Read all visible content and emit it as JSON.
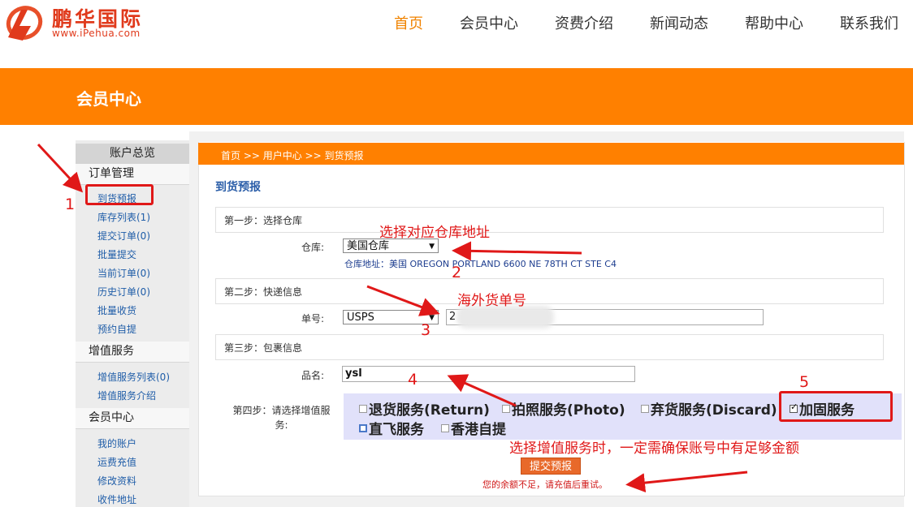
{
  "header": {
    "logo_text": "鹏华国际",
    "logo_url": "www.iPehua.com",
    "nav": [
      "首页",
      "会员中心",
      "资费介绍",
      "新闻动态",
      "帮助中心",
      "联系我们"
    ],
    "active_index": 0
  },
  "banner": {
    "title": "会员中心"
  },
  "sidebar": {
    "overview": "账户总览",
    "groups": [
      {
        "title": "订单管理",
        "items": [
          "到货预报",
          "库存列表(1)",
          "提交订单(0)",
          "批量提交",
          "当前订单(0)",
          "历史订单(0)",
          "批量收货",
          "预约自提"
        ]
      },
      {
        "title": "增值服务",
        "items": [
          "增值服务列表(0)",
          "增值服务介绍"
        ]
      },
      {
        "title": "会员中心",
        "items": [
          "我的账户",
          "运费充值",
          "修改资料",
          "收件地址"
        ]
      }
    ]
  },
  "breadcrumb": "首页 >> 用户中心 >> 到货预报",
  "form": {
    "title": "到货预报",
    "step1": "第一步：选择仓库",
    "warehouse_label": "仓库:",
    "warehouse_value": "美国仓库",
    "address": "仓库地址：美国 OREGON PORTLAND 6600 NE 78TH CT STE C4",
    "step2": "第二步：快递信息",
    "tracking_label": "单号:",
    "carrier_value": "USPS",
    "tracking_value": "2",
    "step3": "第三步：包裹信息",
    "product_label": "品名:",
    "product_value": "ysl",
    "step4_label": "第四步：请选择增值服务:",
    "services": [
      {
        "label": "退货服务(Return)",
        "checked": false
      },
      {
        "label": "拍照服务(Photo)",
        "checked": false
      },
      {
        "label": "弃货服务(Discard)",
        "checked": false
      },
      {
        "label": "加固服务",
        "checked": true
      },
      {
        "label": "直飞服务",
        "checked": false
      },
      {
        "label": "香港自提",
        "checked": false
      }
    ],
    "submit_label": "提交预报",
    "warning": "您的余额不足，请充值后重试。"
  },
  "annotations": {
    "select_warehouse": "选择对应仓库地址",
    "overseas_tracking": "海外货单号",
    "service_note": "选择增值服务时，一定需确保账号中有足够金额",
    "numbers": [
      "1",
      "2",
      "3",
      "4",
      "5"
    ]
  },
  "colors": {
    "brand_orange": "#ff8000",
    "link_blue": "#1f5da8",
    "annotation_red": "#e01818"
  }
}
